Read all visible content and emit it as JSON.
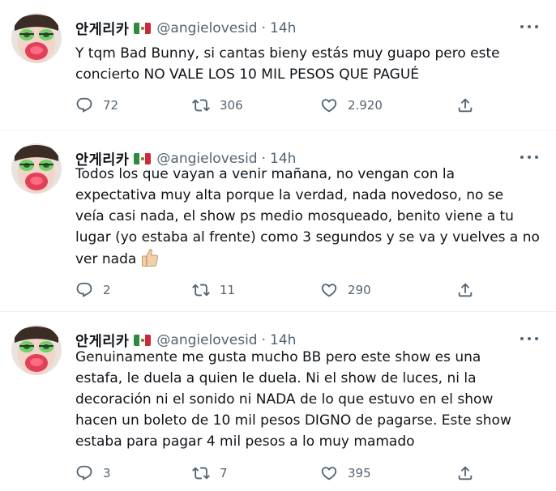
{
  "tweets": [
    {
      "name": "안게리카",
      "handle": "@angielovesid",
      "separator": "·",
      "time": "14h",
      "text": "Y tqm Bad Bunny, si cantas bieny estás muy guapo pero este\nconcierto NO VALE LOS 10 MIL PESOS QUE PAGUÉ",
      "replies": "72",
      "retweets": "306",
      "likes": "2.920"
    },
    {
      "name": "안게리카",
      "handle": "@angielovesid",
      "separator": "·",
      "time": "14h",
      "text": "Todos los que vayan a venir mañana, no vengan con la\nexpectativa muy alta porque la verdad, nada novedoso, no se\nveía casi nada, el show ps medio mosqueado, benito viene a tu\nlugar (yo estaba al frente) como 3 segundos y se va y vuelves a no\nver nada",
      "replies": "2",
      "retweets": "11",
      "likes": "290"
    },
    {
      "name": "안게리카",
      "handle": "@angielovesid",
      "separator": "·",
      "time": "14h",
      "text": "Genuinamente me gusta mucho BB pero este show es una\nestafa, le duela a quien le duela. Ni el show de luces, ni la\ndecoración ni el sonido ni NADA de lo que estuvo en el show\nhacen un boleto de 10 mil pesos DIGNO de pagarse. Este show\nestaba para pagar 4 mil pesos a lo muy mamado",
      "replies": "3",
      "retweets": "7",
      "likes": "395"
    }
  ],
  "icons": {
    "reply": "reply-icon",
    "retweet": "retweet-icon",
    "like": "heart-icon",
    "share": "share-icon",
    "more": "more-icon",
    "flag": "mexico-flag-icon",
    "emoji": "thumbs-up-emoji-icon"
  },
  "colors": {
    "text": "#0f1419",
    "secondary": "#536471",
    "divider": "#eff3f4"
  }
}
